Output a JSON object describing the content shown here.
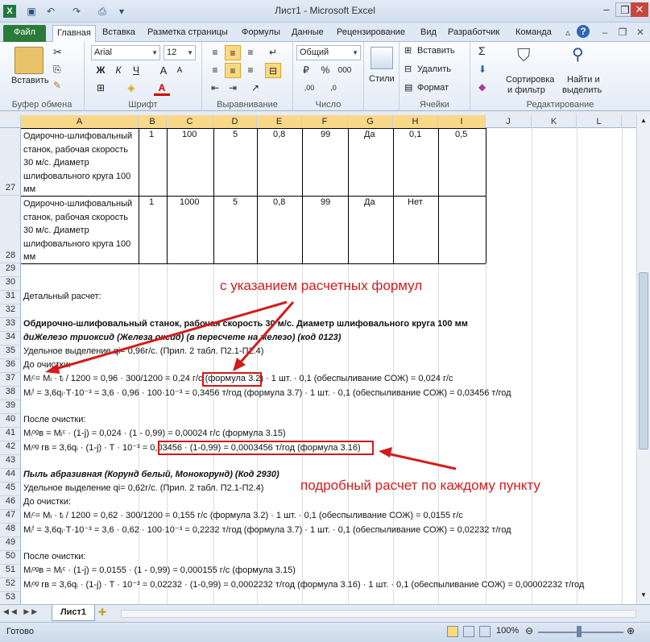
{
  "window": {
    "title": "Лист1  -  Microsoft Excel"
  },
  "tabs": [
    "Файл",
    "Главная",
    "Вставка",
    "Разметка страницы",
    "Формулы",
    "Данные",
    "Рецензирование",
    "Вид",
    "Разработчик",
    "Команда"
  ],
  "ribbon": {
    "paste_label": "Вставить",
    "font_name": "Arial",
    "font_size": "12",
    "number_format": "Общий",
    "styles_label": "Стили",
    "insert_label": "Вставить",
    "delete_label": "Удалить",
    "format_label": "Формат",
    "sort_label_1": "Сортировка",
    "sort_label_2": "и фильтр",
    "find_label_1": "Найти и",
    "find_label_2": "выделить",
    "groups": [
      "Буфер обмена",
      "Шрифт",
      "Выравнивание",
      "Число",
      "Ячейки",
      "Редактирование"
    ],
    "bold": "Ж",
    "italic": "К",
    "underline": "Ч"
  },
  "columns": [
    "A",
    "B",
    "C",
    "D",
    "E",
    "F",
    "G",
    "H",
    "I",
    "J",
    "K",
    "L"
  ],
  "rows": {
    "r27": {
      "num": "27",
      "a": [
        "Одирочно-шлифовальный",
        "станок, рабочая скорость",
        "30 м/с. Диаметр",
        "шлифовального круга 100",
        "мм"
      ],
      "b": "1",
      "c": "100",
      "d": "5",
      "e": "0,8",
      "f": "99",
      "g": "Да",
      "h": "0,1",
      "i": "0,5"
    },
    "r28": {
      "num": "28",
      "a": [
        "Одирочно-шлифовальный",
        "станок, рабочая скорость",
        "30 м/с. Диаметр",
        "шлифовального круга 100",
        "мм"
      ],
      "b": "1",
      "c": "1000",
      "d": "5",
      "e": "0,8",
      "f": "99",
      "g": "Да",
      "h": "Нет",
      "i": ""
    },
    "lines": [
      {
        "num": "29",
        "text": ""
      },
      {
        "num": "30",
        "text": ""
      },
      {
        "num": "31",
        "text": "Детальный расчет:"
      },
      {
        "num": "32",
        "text": ""
      },
      {
        "num": "33",
        "text": "Обдирочно-шлифовальный станок, рабочая скорость 30 м/с. Диаметр шлифовального круга 100 мм"
      },
      {
        "num": "34",
        "text": "диЖелезо триоксид (Железа оксид) (в пересчете на железо) (код 0123)"
      },
      {
        "num": "35",
        "text": "Удельное выделение qi= 0,96г/с. (Прил. 2 табл. П2.1-П2.4)"
      },
      {
        "num": "36",
        "text": "До очистки:"
      },
      {
        "num": "37",
        "text": "Mᵢᶜ= Mᵢ · tᵢ / 1200 = 0,96 · 300/1200  = 0,24 г/с (формула 3.2)  · 1 шт. · 0,1 (обеспыливание СОЖ) = 0,024 г/с"
      },
      {
        "num": "38",
        "text": "Mᵢᶠ =  3,6qᵢ·T·10⁻³ = 3,6 · 0,96 · 100·10⁻³  = 0,3456 т/год  (формула 3.7)  · 1 шт. · 0,1 (обеспыливание СОЖ) = 0,03456 т/год"
      },
      {
        "num": "39",
        "text": ""
      },
      {
        "num": "40",
        "text": "После очистки:"
      },
      {
        "num": "41",
        "text": "Mᵢᵒᵍв =  Mᵢᶜ · (1-j)  = 0,024 · (1 - 0,99)  = 0,00024 г/с  (формула 3.15)"
      },
      {
        "num": "42",
        "text": "Mᵢᵒᵍ гв =  3,6qᵢ · (1-j) · T · 10⁻³ = 0,03456 · (1-0,99)  = 0,0003456 т/год  (формула 3.16)"
      },
      {
        "num": "43",
        "text": ""
      },
      {
        "num": "44",
        "text": "Пыль абразивная (Корунд белый, Монокорунд) (Код 2930)"
      },
      {
        "num": "45",
        "text": "Удельное выделение qi= 0,62г/с. (Прил. 2 табл. П2.1-П2.4)"
      },
      {
        "num": "46",
        "text": "До очистки:"
      },
      {
        "num": "47",
        "text": "Mᵢᶜ= Mᵢ · tᵢ / 1200 = 0,62 · 300/1200  = 0,155 г/с (формула 3.2)  · 1 шт. · 0,1 (обеспыливание СОЖ) = 0,0155 г/с"
      },
      {
        "num": "48",
        "text": "Mᵢᶠ =  3,6qᵢ·T·10⁻³ = 3,6 · 0,62 · 100·10⁻³  = 0,2232 т/год  (формула 3.7)  · 1 шт. · 0,1 (обеспыливание СОЖ) = 0,02232 т/год"
      },
      {
        "num": "49",
        "text": ""
      },
      {
        "num": "50",
        "text": "После очистки:"
      },
      {
        "num": "51",
        "text": "Mᵢᵒᵍв =  Mᵢᶜ · (1-j)  = 0,0155 · (1 - 0,99)  = 0,000155 г/с  (формула 3.15)"
      },
      {
        "num": "52",
        "text": "Mᵢᵒᵍ гв =  3,6qᵢ · (1-j) · T · 10⁻³ =  0,02232 · (1-0,99)  = 0,0002232 т/год  (формула 3.16)  · 1 шт. · 0,1 (обеспыливание СОЖ) = 0,00002232 т/год"
      },
      {
        "num": "53",
        "text": ""
      }
    ]
  },
  "annotations": {
    "top": "с указанием расчетных формул",
    "bottom": "подробный расчет по каждому пункту",
    "color": "#d41b1b"
  },
  "sheet_tab": "Лист1",
  "status": {
    "ready": "Готово",
    "zoom": "100%"
  }
}
